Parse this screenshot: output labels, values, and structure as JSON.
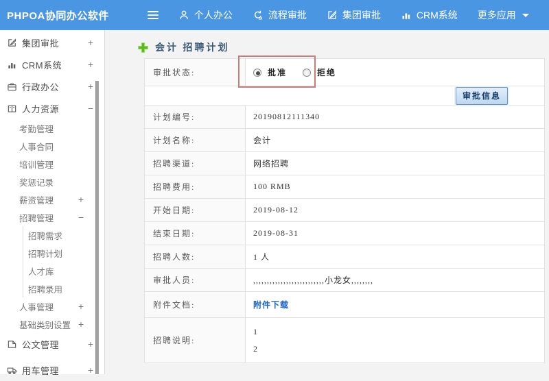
{
  "topbar": {
    "brand": "PHPOA协同办公软件",
    "nav": [
      {
        "icon": "user-icon",
        "label": "个人办公"
      },
      {
        "icon": "process-icon",
        "label": "流程审批"
      },
      {
        "icon": "edit-icon",
        "label": "集团审批"
      },
      {
        "icon": "bar-chart-icon",
        "label": "CRM系统"
      },
      {
        "icon": "caret-down-icon",
        "label": "更多应用"
      }
    ]
  },
  "sidebar": {
    "items": [
      {
        "icon": "edit-icon",
        "label": "集团审批",
        "toggle": "+"
      },
      {
        "icon": "bar-chart-icon",
        "label": "CRM系统",
        "toggle": "+"
      },
      {
        "icon": "briefcase-icon",
        "label": "行政办公",
        "toggle": "+"
      },
      {
        "icon": "book-icon",
        "label": "人力资源",
        "toggle": "−",
        "children": [
          {
            "label": "考勤管理"
          },
          {
            "label": "人事合同"
          },
          {
            "label": "培训管理"
          },
          {
            "label": "奖惩记录"
          },
          {
            "label": "薪资管理",
            "toggle": "+"
          },
          {
            "label": "招聘管理",
            "toggle": "−",
            "children": [
              {
                "label": "招聘需求"
              },
              {
                "label": "招聘计划"
              },
              {
                "label": "人才库"
              },
              {
                "label": "招聘录用"
              }
            ]
          },
          {
            "label": "人事管理",
            "toggle": "+"
          },
          {
            "label": "基础类别设置",
            "toggle": "+"
          }
        ]
      },
      {
        "icon": "document-icon",
        "label": "公文管理",
        "toggle": "+"
      },
      {
        "icon": "truck-icon",
        "label": "用车管理",
        "toggle": "+"
      }
    ]
  },
  "main": {
    "title": "会计 招聘计划",
    "status_row": {
      "label": "审批状态:",
      "approve": "批准",
      "reject": "拒绝",
      "selected": "批准"
    },
    "approve_button": "审批信息",
    "rows": [
      {
        "label": "计划编号:",
        "value": "20190812111340"
      },
      {
        "label": "计划名称:",
        "value": "会计"
      },
      {
        "label": "招聘渠道:",
        "value": "网络招聘"
      },
      {
        "label": "招聘费用:",
        "value": "100 RMB"
      },
      {
        "label": "开始日期:",
        "value": "2019-08-12"
      },
      {
        "label": "结束日期:",
        "value": "2019-08-31"
      },
      {
        "label": "招聘人数:",
        "value": "1 人"
      },
      {
        "label": "审批人员:",
        "value": ",,,,,,,,,,,,,,,,,,,,,,,,,,小龙女,,,,,,,,"
      }
    ],
    "attachment_row": {
      "label": "附件文档:",
      "link": "附件下载"
    },
    "description_row": {
      "label": "招聘说明:",
      "line1": "1",
      "line2": "2"
    }
  },
  "colors": {
    "topbar_blue": "#4a96e3",
    "content_bg": "#f3f3f3",
    "title_blue": "#3b5a76",
    "link_blue": "#1763c5",
    "annotation_red": "#c97b7b",
    "plus_icon_green": "#5cb81e"
  }
}
